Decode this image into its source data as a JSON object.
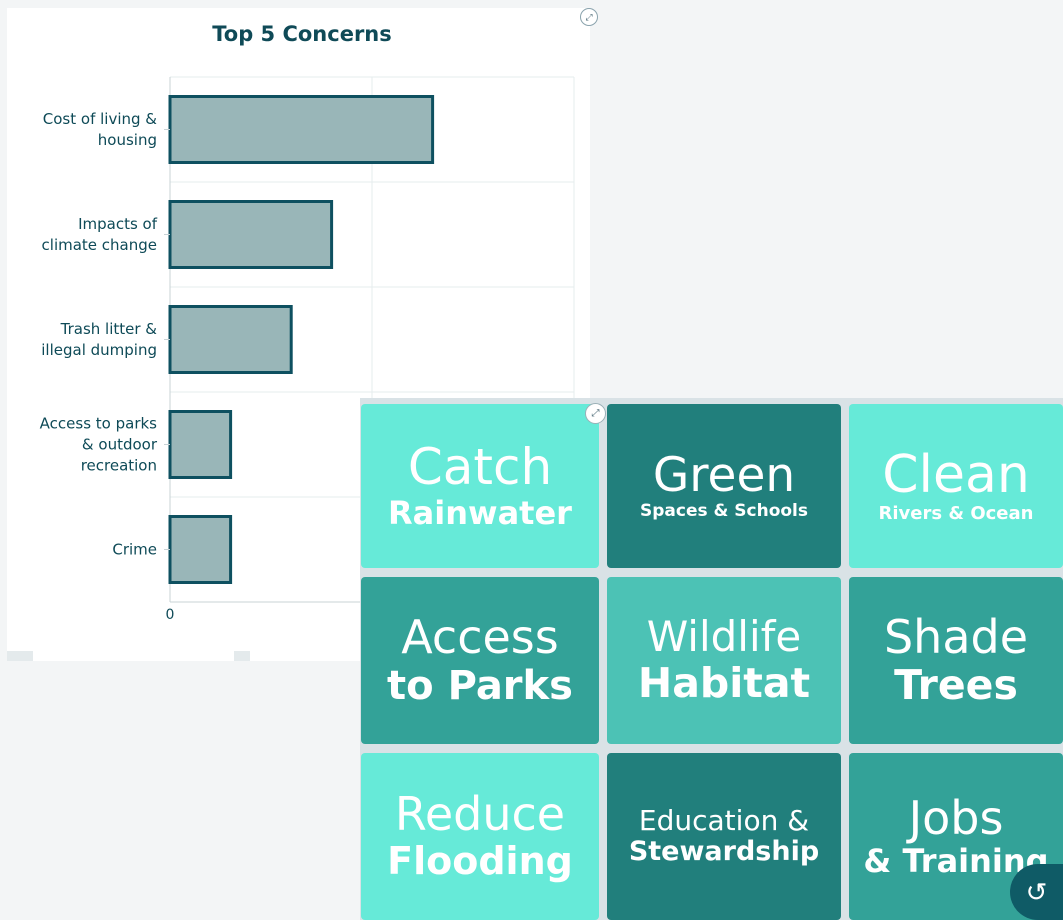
{
  "chart_data": {
    "type": "bar",
    "orientation": "horizontal",
    "title": "Top 5 Concerns",
    "categories": [
      [
        "Cost of living &",
        "housing"
      ],
      [
        "Impacts of",
        "climate change"
      ],
      [
        "Trash litter &",
        "illegal dumping"
      ],
      [
        "Access to parks",
        "& outdoor",
        "recreation"
      ],
      [
        "Crime"
      ]
    ],
    "values": [
      13,
      8,
      6,
      3,
      3
    ],
    "xlim": [
      0,
      20
    ],
    "x_tick_labels": [
      "0"
    ],
    "grid": true,
    "colors": {
      "bar_fill": "#99b6b8",
      "bar_stroke": "#0e5060",
      "text": "#0e4a57"
    }
  },
  "tiles": [
    {
      "line1": "Catch",
      "line2": "Rainwater",
      "color": "light"
    },
    {
      "line1": "Green",
      "line2": "Spaces & Schools",
      "color": "dark"
    },
    {
      "line1": "Clean",
      "line2": "Rivers & Ocean",
      "color": "light"
    },
    {
      "line1": "Access",
      "line2": "to Parks",
      "color": "mid"
    },
    {
      "line1": "Wildlife",
      "line2": "Habitat",
      "color": "mid2"
    },
    {
      "line1": "Shade",
      "line2": "Trees",
      "color": "mid"
    },
    {
      "line1": "Reduce",
      "line2": "Flooding",
      "color": "light"
    },
    {
      "line1": "Education &",
      "line2": "Stewardship",
      "color": "dark"
    },
    {
      "line1": "Jobs",
      "line2": "& Training",
      "color": "mid"
    }
  ],
  "icons": {
    "chart_expand": "expand-icon",
    "tile_expand": "expand-icon",
    "reset": "reset-icon"
  },
  "glyphs": {
    "expand": "⤢",
    "reset": "↺"
  }
}
